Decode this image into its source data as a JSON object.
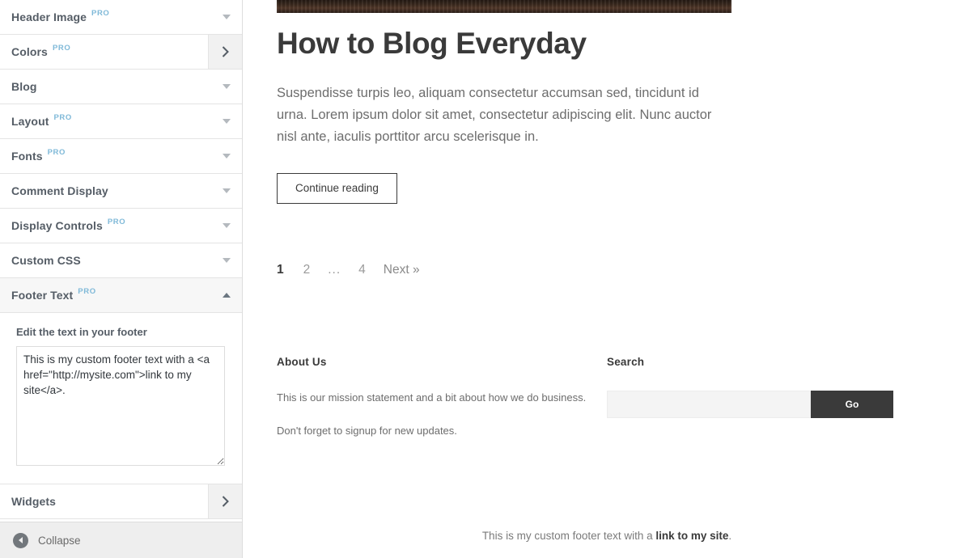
{
  "sidebar": {
    "sections": [
      {
        "label": "Header Image",
        "pro": "PRO",
        "control": "caret-down",
        "state": "collapsed"
      },
      {
        "label": "Colors",
        "pro": "PRO",
        "control": "chevron-right",
        "state": "collapsed"
      },
      {
        "label": "Blog",
        "pro": "",
        "control": "caret-down",
        "state": "collapsed"
      },
      {
        "label": "Layout",
        "pro": "PRO",
        "control": "caret-down",
        "state": "collapsed"
      },
      {
        "label": "Fonts",
        "pro": "PRO",
        "control": "caret-down",
        "state": "collapsed"
      },
      {
        "label": "Comment Display",
        "pro": "",
        "control": "caret-down",
        "state": "collapsed"
      },
      {
        "label": "Display Controls",
        "pro": "PRO",
        "control": "caret-down",
        "state": "collapsed"
      },
      {
        "label": "Custom CSS",
        "pro": "",
        "control": "caret-down",
        "state": "collapsed"
      },
      {
        "label": "Footer Text",
        "pro": "PRO",
        "control": "caret-up",
        "state": "expanded"
      }
    ],
    "footer_text_panel": {
      "field_label": "Edit the text in your footer",
      "textarea_value": "This is my custom footer text with a <a href=\"http://mysite.com\">link to my site</a>.",
      "textarea_placeholder": ""
    },
    "widgets_section": {
      "label": "Widgets",
      "pro": "",
      "control": "chevron-right"
    },
    "collapse": {
      "label": "Collapse",
      "icon": "collapse-left-icon"
    }
  },
  "preview": {
    "header_image_alt": "header-image-banner",
    "post": {
      "title": "How to Blog Everyday",
      "excerpt": "Suspendisse turpis leo, aliquam consectetur accumsan sed, tincidunt id urna. Lorem ipsum dolor sit amet, consectetur adipiscing elit. Nunc auctor nisl ante, iaculis porttitor arcu scelerisque in.",
      "continue_label": "Continue reading"
    },
    "pagination": {
      "items": [
        {
          "label": "1",
          "current": true
        },
        {
          "label": "2",
          "current": false
        },
        {
          "label": "...",
          "current": false
        },
        {
          "label": "4",
          "current": false
        },
        {
          "label": "Next »",
          "current": false
        }
      ]
    },
    "footer_widgets": {
      "about": {
        "title": "About Us",
        "line1": "This is our mission statement and a bit about how we do business.",
        "line2": "Don't forget to signup for new updates."
      },
      "search": {
        "title": "Search",
        "input_value": "",
        "input_placeholder": "",
        "submit_label": "Go"
      }
    },
    "site_footer": {
      "text_before": "This is my custom footer text with a ",
      "link_text": "link to my site",
      "text_after": "."
    }
  },
  "colors": {
    "pro_badge": "#7fb9d8",
    "accent_dark": "#3a3a3a",
    "sidebar_border": "#dddddd",
    "collapse_bar": "#eeeeee",
    "header_image": "#3d2b1f"
  }
}
